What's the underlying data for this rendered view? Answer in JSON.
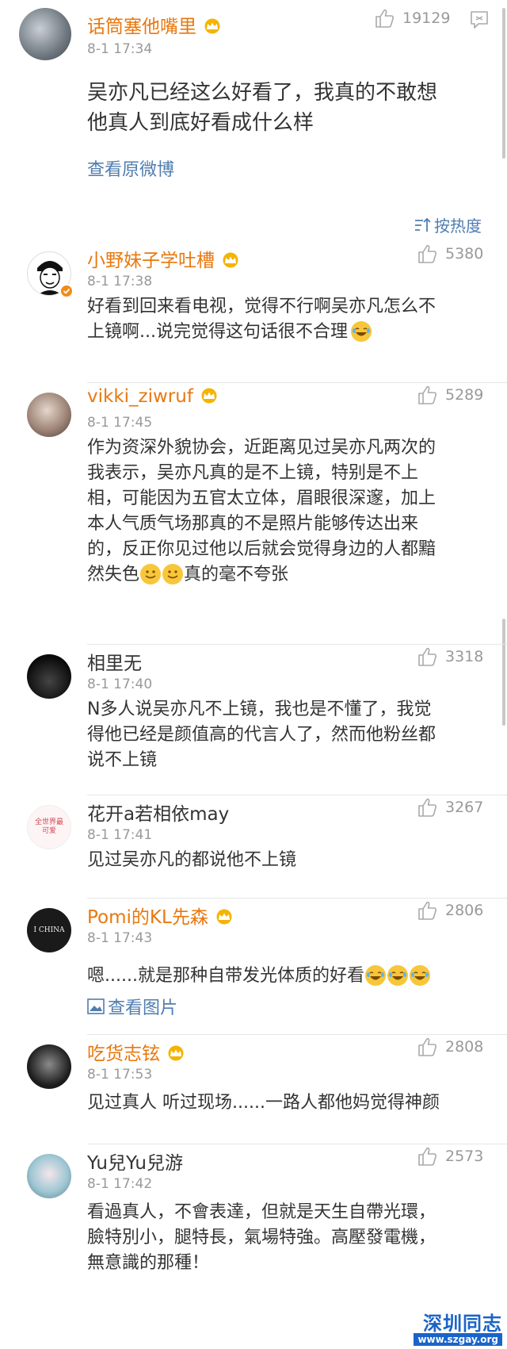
{
  "post": {
    "username": "话筒塞他嘴里",
    "time": "8-1 17:34",
    "likes": "19129",
    "text_line1": "吴亦凡已经这么好看了，我真的不敢想",
    "text_line2": "他真人到底好看成什么样",
    "view_original": "查看原微博"
  },
  "sort": {
    "label": "按热度"
  },
  "comments": [
    {
      "username": "小野妹子学吐槽",
      "time": "8-1 17:38",
      "likes": "5380",
      "lines": [
        "好看到回来看电视，觉得不行啊吴亦凡怎么不",
        "上镜啊...说完觉得这句话很不合理"
      ]
    },
    {
      "username": "vikki_ziwruf",
      "time": "8-1 17:45",
      "likes": "5289",
      "lines": [
        "作为资深外貌协会，近距离见过吴亦凡两次的",
        "我表示，吴亦凡真的是不上镜，特别是不上",
        "相，可能因为五官太立体，眉眼很深邃，加上",
        "本人气质气场那真的不是照片能够传达出来",
        "的，反正你见过他以后就会觉得身边的人都黯",
        "然失色",
        "真的毫不夸张"
      ]
    },
    {
      "username": "相里无",
      "time": "8-1 17:40",
      "likes": "3318",
      "lines": [
        "N多人说吴亦凡不上镜，我也是不懂了，我觉",
        "得他已经是颜值高的代言人了，然而他粉丝都",
        "说不上镜"
      ]
    },
    {
      "username": "花开a若相依may",
      "time": "8-1 17:41",
      "likes": "3267",
      "lines": [
        "见过吴亦凡的都说他不上镜"
      ],
      "avatar_text": "全世界最可爱"
    },
    {
      "username": "Pomi的KL先森",
      "time": "8-1 17:43",
      "likes": "2806",
      "lines": [
        "嗯......就是那种自带发光体质的好看"
      ],
      "link": "查看图片",
      "avatar_text": "I CHINA"
    },
    {
      "username": "吃货志铉",
      "time": "8-1 17:53",
      "likes": "2808",
      "lines": [
        "见过真人 听过现场......一路人都他妈觉得神颜"
      ]
    },
    {
      "username": "Yu兒Yu兒游",
      "time": "8-1 17:42",
      "likes": "2573",
      "lines": [
        "看過真人，不會表達，但就是天生自帶光環，",
        "臉特別小，腿特長，氣場特強。高壓發電機，",
        "無意識的那種！"
      ]
    }
  ],
  "watermark": {
    "line1": "深圳同志",
    "line2": "www.szgay.org"
  },
  "colors": {
    "username": "#e8780e",
    "link": "#507daf",
    "emoji": "#f7c63a"
  }
}
